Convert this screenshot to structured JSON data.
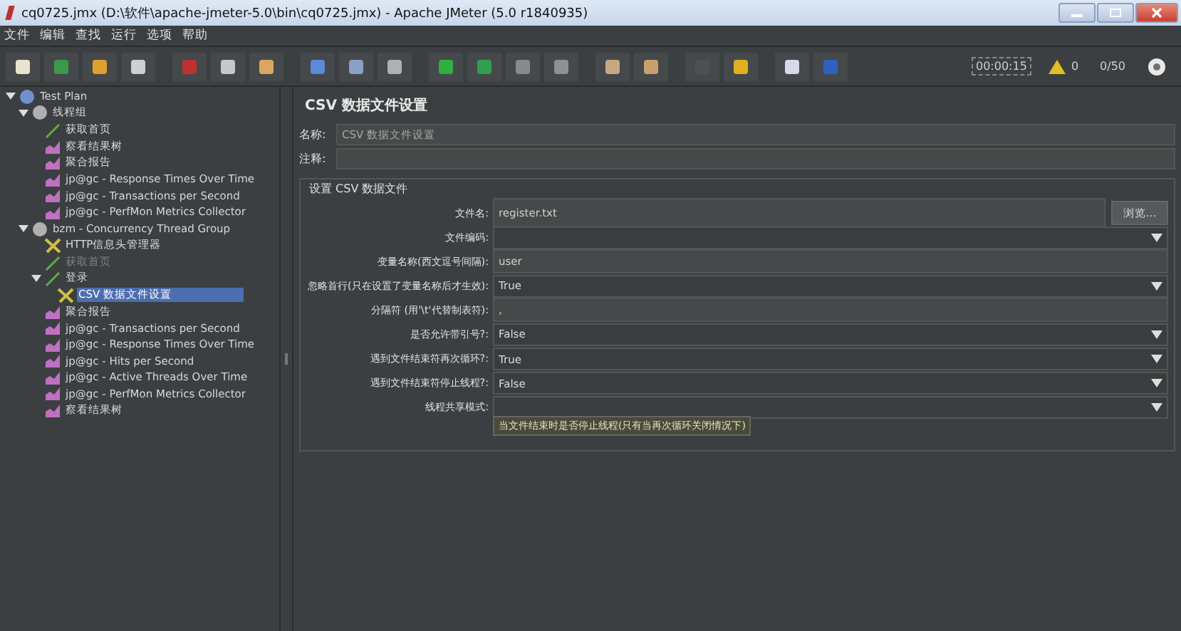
{
  "window": {
    "title": "cq0725.jmx (D:\\软件\\apache-jmeter-5.0\\bin\\cq0725.jmx) - Apache JMeter (5.0 r1840935)"
  },
  "menu": [
    "文件",
    "编辑",
    "查找",
    "运行",
    "选项",
    "帮助"
  ],
  "toolbar": {
    "timer": "00:00:15",
    "warnings": "0",
    "threads": "0/50"
  },
  "tree": [
    {
      "label": "Test Plan",
      "kind": "plan",
      "expanded": true,
      "selected": false,
      "disabled": false,
      "children": [
        {
          "label": "线程组",
          "kind": "group",
          "expanded": true,
          "selected": false,
          "disabled": false,
          "children": [
            {
              "label": "获取首页",
              "kind": "sampler",
              "selected": false,
              "disabled": false
            },
            {
              "label": "察看结果树",
              "kind": "listener",
              "selected": false,
              "disabled": false
            },
            {
              "label": "聚合报告",
              "kind": "listener",
              "selected": false,
              "disabled": false
            },
            {
              "label": "jp@gc - Response Times Over Time",
              "kind": "listener",
              "selected": false,
              "disabled": false
            },
            {
              "label": "jp@gc - Transactions per Second",
              "kind": "listener",
              "selected": false,
              "disabled": false
            },
            {
              "label": "jp@gc - PerfMon Metrics Collector",
              "kind": "listener",
              "selected": false,
              "disabled": false
            }
          ]
        },
        {
          "label": "bzm - Concurrency Thread Group",
          "kind": "group",
          "expanded": true,
          "selected": false,
          "disabled": false,
          "children": [
            {
              "label": "HTTP信息头管理器",
              "kind": "config",
              "selected": false,
              "disabled": false
            },
            {
              "label": "获取首页",
              "kind": "sampler",
              "selected": false,
              "disabled": true
            },
            {
              "label": "登录",
              "kind": "sampler",
              "expanded": true,
              "selected": false,
              "disabled": false,
              "children": [
                {
                  "label": "CSV 数据文件设置",
                  "kind": "config",
                  "selected": true,
                  "disabled": false
                }
              ]
            },
            {
              "label": "聚合报告",
              "kind": "listener",
              "selected": false,
              "disabled": false
            },
            {
              "label": "jp@gc - Transactions per Second",
              "kind": "listener",
              "selected": false,
              "disabled": false
            },
            {
              "label": "jp@gc - Response Times Over Time",
              "kind": "listener",
              "selected": false,
              "disabled": false
            },
            {
              "label": "jp@gc - Hits per Second",
              "kind": "listener",
              "selected": false,
              "disabled": false
            },
            {
              "label": "jp@gc - Active Threads Over Time",
              "kind": "listener",
              "selected": false,
              "disabled": false
            },
            {
              "label": "jp@gc - PerfMon Metrics Collector",
              "kind": "listener",
              "selected": false,
              "disabled": false
            },
            {
              "label": "察看结果树",
              "kind": "listener",
              "selected": false,
              "disabled": false
            }
          ]
        }
      ]
    }
  ],
  "panel": {
    "title": "CSV 数据文件设置",
    "name_label": "名称:",
    "name_value": "CSV 数据文件设置",
    "comment_label": "注释:",
    "section_title": "设置 CSV 数据文件",
    "fields": [
      {
        "label": "文件名:",
        "kind": "text",
        "value": "register.txt",
        "button": "浏览..."
      },
      {
        "label": "文件编码:",
        "kind": "select"
      },
      {
        "label": "变量名称(西文逗号间隔):",
        "kind": "text",
        "value": "user"
      },
      {
        "label": "忽略首行(只在设置了变量名称后才生效):",
        "kind": "select",
        "value": "True"
      },
      {
        "label": "分隔符 (用'\\t'代替制表符):",
        "kind": "text",
        "value": ","
      },
      {
        "label": "是否允许带引号?:",
        "kind": "select",
        "value": "False"
      },
      {
        "label": "遇到文件结束符再次循环?:",
        "kind": "select",
        "value": "True"
      },
      {
        "label": "遇到文件结束符停止线程?:",
        "kind": "select",
        "value": "False"
      },
      {
        "label": "线程共享模式:",
        "kind": "select"
      }
    ],
    "tooltip": "当文件结束时是否停止线程(只有当再次循环关闭情况下)"
  }
}
